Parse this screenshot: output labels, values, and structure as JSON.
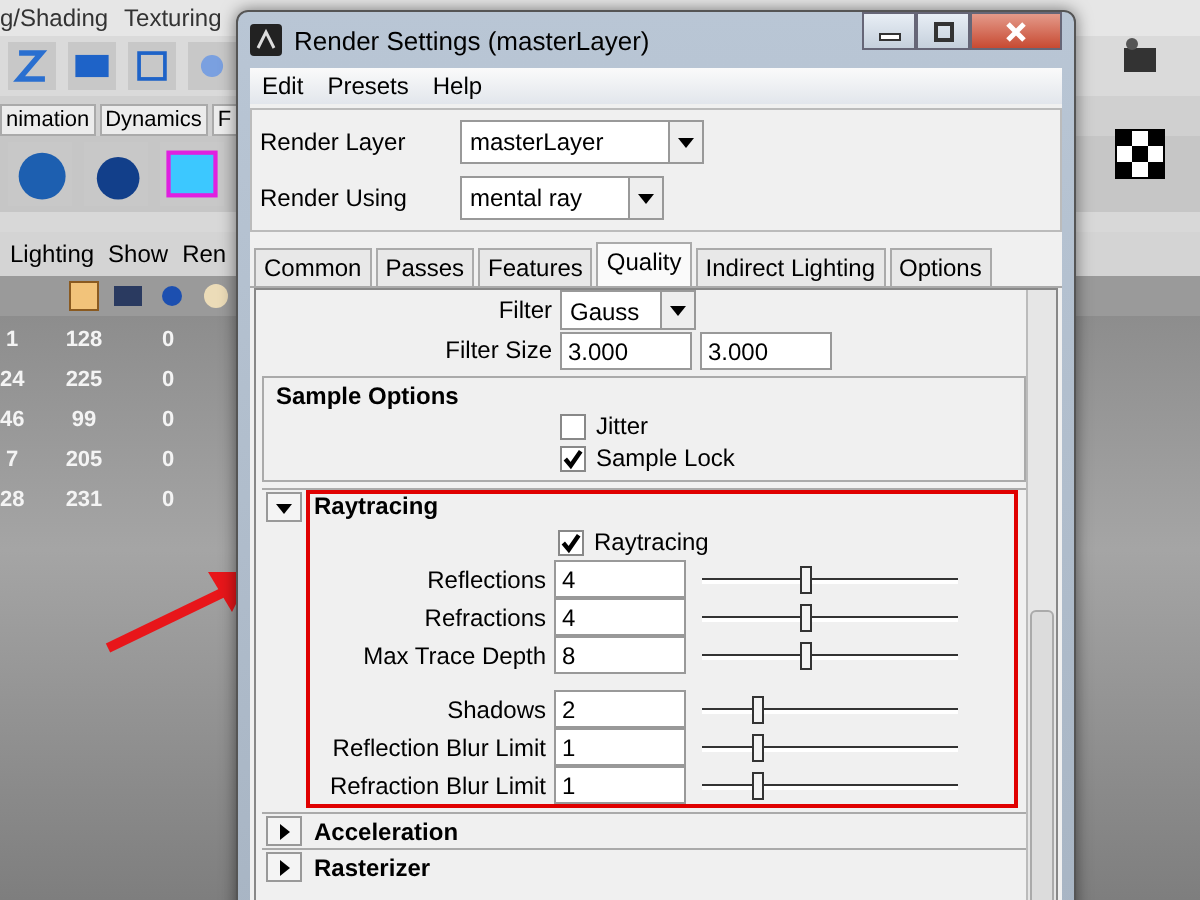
{
  "background": {
    "menu": [
      "g/Shading",
      "Texturing"
    ],
    "shelf_tabs": [
      "nimation",
      "Dynamics",
      "F"
    ],
    "panel_menu": [
      "Lighting",
      "Show",
      "Ren"
    ],
    "table_rows": [
      [
        "1",
        "128",
        "0"
      ],
      [
        "24",
        "225",
        "0"
      ],
      [
        "46",
        "99",
        "0"
      ],
      [
        "7",
        "205",
        "0"
      ],
      [
        "28",
        "231",
        "0"
      ]
    ]
  },
  "window": {
    "title": "Render Settings (masterLayer)",
    "menu": [
      "Edit",
      "Presets",
      "Help"
    ],
    "render_layer": {
      "label": "Render Layer",
      "value": "masterLayer"
    },
    "render_using": {
      "label": "Render Using",
      "value": "mental ray"
    },
    "tabs": [
      {
        "label": "Common",
        "selected": false
      },
      {
        "label": "Passes",
        "selected": false
      },
      {
        "label": "Features",
        "selected": false
      },
      {
        "label": "Quality",
        "selected": true
      },
      {
        "label": "Indirect Lighting",
        "selected": false
      },
      {
        "label": "Options",
        "selected": false
      }
    ],
    "filter": {
      "label": "Filter",
      "value": "Gauss"
    },
    "filter_size": {
      "label": "Filter Size",
      "values": [
        "3.000",
        "3.000"
      ]
    },
    "sections": [
      {
        "kind": "frame",
        "title": "Sample Options",
        "checkboxes": [
          {
            "label": "Jitter",
            "checked": false
          },
          {
            "label": "Sample Lock",
            "checked": true
          }
        ]
      },
      {
        "kind": "collapsible",
        "title": "Raytracing",
        "expanded": true,
        "highlighted": true,
        "checkboxes": [
          {
            "label": "Raytracing",
            "checked": true
          }
        ],
        "row_groups": [
          [
            {
              "label": "Reflections",
              "value": "4",
              "level": 0.41
            },
            {
              "label": "Refractions",
              "value": "4",
              "level": 0.41
            },
            {
              "label": "Max Trace Depth",
              "value": "8",
              "level": 0.41
            }
          ],
          [
            {
              "label": "Shadows",
              "value": "2",
              "level": 0.22
            },
            {
              "label": "Reflection Blur Limit",
              "value": "1",
              "level": 0.22
            },
            {
              "label": "Refraction Blur Limit",
              "value": "1",
              "level": 0.22
            }
          ]
        ]
      },
      {
        "kind": "collapsible",
        "title": "Acceleration",
        "expanded": false
      },
      {
        "kind": "collapsible",
        "title": "Rasterizer",
        "expanded": false
      }
    ]
  }
}
